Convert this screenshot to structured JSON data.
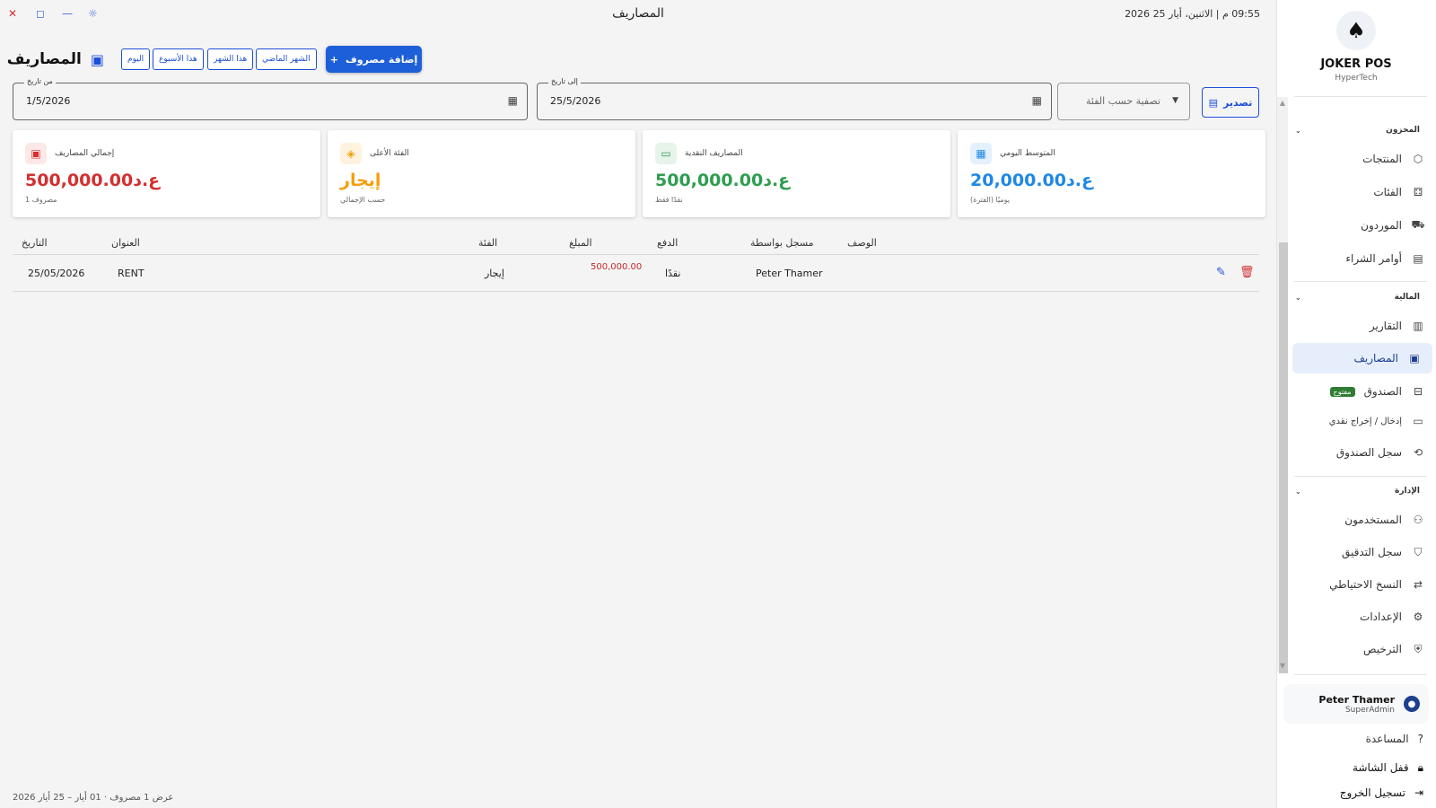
{
  "window": {
    "title": "المصاريف",
    "datetime": "09:55 م  |  الاثنين، أيار 25 2026"
  },
  "page": {
    "title": "المصاريف",
    "add_button": "إضافة مصروف",
    "quick_filters": [
      "الشهر الماضي",
      "هذا الشهر",
      "هذا الأسبوع",
      "اليوم"
    ]
  },
  "filters": {
    "from_label": "من تاريخ",
    "from_value": "1/5/2026",
    "to_label": "إلى تاريخ",
    "to_value": "25/5/2026",
    "category_placeholder": "تصفية حسب الفئة",
    "export_label": "تصدير"
  },
  "cards": [
    {
      "title": "إجمالي المصاريف",
      "value": "500,000.00ع.د",
      "sub": "مصروف 1",
      "color": "#d32f2f"
    },
    {
      "title": "الفئة الأعلى",
      "value": "إيجار",
      "sub": "حسب الإجمالي",
      "color": "#f59e0b"
    },
    {
      "title": "المصاريف النقدية",
      "value": "500,000.00ع.د",
      "sub": "نقدًا فقط",
      "color": "#2e9d4f"
    },
    {
      "title": "المتوسط اليومي",
      "value": "20,000.00ع.د",
      "sub": "يوميًا (الفترة)",
      "color": "#1e88e5"
    }
  ],
  "table": {
    "headers": {
      "date": "التاريخ",
      "title": "العنوان",
      "category": "الفئة",
      "amount": "المبلغ",
      "payment": "الدفع",
      "recorded_by": "مسجل بواسطة",
      "description": "الوصف"
    },
    "rows": [
      {
        "date": "25/05/2026",
        "title": "RENT",
        "category": "إيجار",
        "amount": "500,000.00",
        "payment": "نقدًا",
        "recorded_by": "Peter Thamer",
        "description": ""
      }
    ]
  },
  "footer_note": "عرض 1 مصروف · 01 أيار – 25 أيار 2026",
  "sidebar": {
    "brand": "JOKER POS",
    "brand_sub": "HyperTech",
    "sections": {
      "inventory": "المخزون",
      "finance": "المالية",
      "admin": "الإدارة"
    },
    "items": {
      "products": "المنتجات",
      "categories": "الفئات",
      "suppliers": "الموردون",
      "purchase_orders": "أوامر الشراء",
      "reports": "التقارير",
      "expenses": "المصاريف",
      "cashbox": "الصندوق",
      "cashbox_badge": "مفتوح",
      "cash_in_out": "إدخال / إخراج نقدي",
      "cashbox_log": "سجل الصندوق",
      "users": "المستخدمون",
      "audit_log": "سجل التدقيق",
      "backup": "النسخ الاحتياطي",
      "settings": "الإعدادات",
      "license": "الترخيص"
    },
    "user": {
      "name": "Peter Thamer",
      "role": "SuperAdmin"
    },
    "footer": {
      "help": "المساعدة",
      "lock": "قفل الشاشة",
      "logout": "تسجيل الخروج"
    }
  },
  "colors": {
    "primary": "#1d5fd8",
    "danger": "#d32f2f",
    "success": "#2e9d4f",
    "warning": "#f59e0b",
    "info": "#1e88e5"
  }
}
